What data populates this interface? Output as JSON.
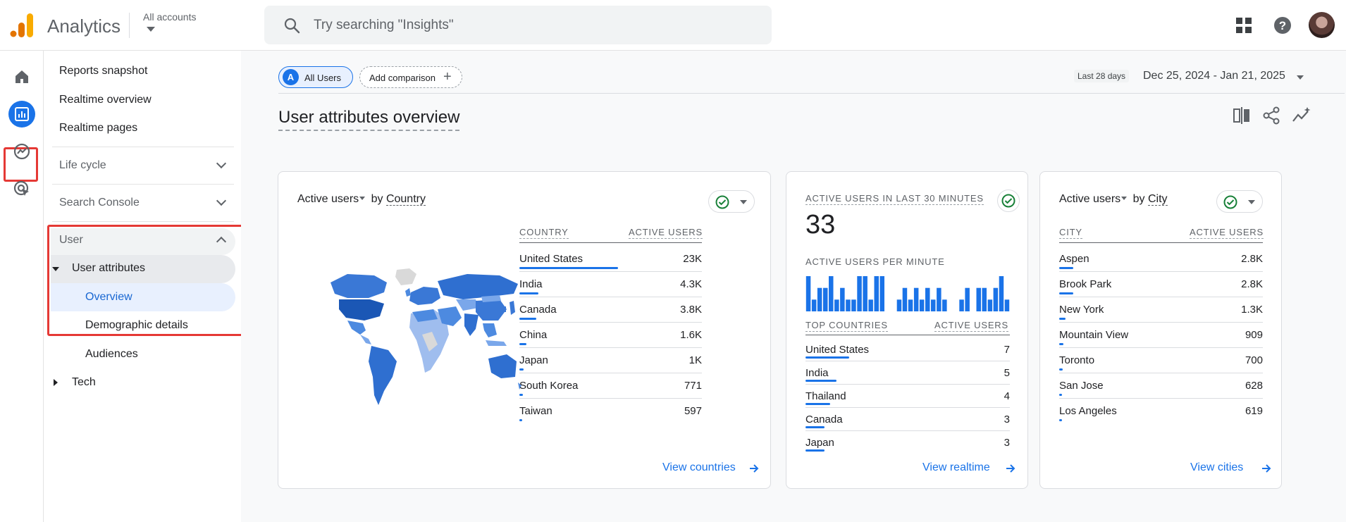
{
  "app": {
    "title": "Analytics",
    "account_label": "All accounts"
  },
  "search": {
    "placeholder": "Try searching \"Insights\""
  },
  "icons": {
    "logo": "analytics-logo-icon",
    "search": "search-icon",
    "apps": "apps-grid-icon",
    "help": "help-icon",
    "rail": [
      "home-icon",
      "reports-icon",
      "explore-icon",
      "advertising-icon"
    ],
    "toolbar": [
      "compare-icon",
      "share-icon",
      "insights-icon"
    ]
  },
  "colors": {
    "accent": "#1a73e8",
    "highlight": "#e53935",
    "success": "#188038"
  },
  "nav": {
    "top_items": [
      "Reports snapshot",
      "Realtime overview",
      "Realtime pages"
    ],
    "sections": {
      "life_cycle": "Life cycle",
      "search_console": "Search Console",
      "user": "User"
    },
    "user_attributes": "User attributes",
    "user_sub": [
      "Overview",
      "Demographic details"
    ],
    "audiences": "Audiences",
    "tech": "Tech"
  },
  "header": {
    "all_users": "All Users",
    "all_users_badge": "A",
    "add_comparison": "Add comparison",
    "last_days": "Last 28 days",
    "date_range": "Dec 25, 2024 - Jan 21, 2025",
    "page_title": "User attributes overview"
  },
  "country_card": {
    "metric": "Active users",
    "by": "by",
    "dimension": "Country",
    "col_country": "COUNTRY",
    "col_users": "ACTIVE USERS",
    "rows": [
      {
        "name": "United States",
        "value": "23K",
        "share": 1.0
      },
      {
        "name": "India",
        "value": "4.3K",
        "share": 0.19
      },
      {
        "name": "Canada",
        "value": "3.8K",
        "share": 0.17
      },
      {
        "name": "China",
        "value": "1.6K",
        "share": 0.07
      },
      {
        "name": "Japan",
        "value": "1K",
        "share": 0.045
      },
      {
        "name": "South Korea",
        "value": "771",
        "share": 0.034
      },
      {
        "name": "Taiwan",
        "value": "597",
        "share": 0.026
      }
    ],
    "link": "View countries"
  },
  "realtime_card": {
    "title": "ACTIVE USERS IN LAST 30 MINUTES",
    "count": "33",
    "per_minute_label": "ACTIVE USERS PER MINUTE",
    "per_minute": [
      3,
      1,
      2,
      2,
      3,
      1,
      2,
      1,
      1,
      3,
      3,
      1,
      3,
      3,
      0,
      0,
      1,
      2,
      1,
      2,
      1,
      2,
      1,
      2,
      1,
      0,
      0,
      1,
      2,
      0,
      2,
      2,
      1,
      2,
      3,
      1
    ],
    "col_countries": "TOP COUNTRIES",
    "col_users": "ACTIVE USERS",
    "rows": [
      {
        "name": "United States",
        "value": "7",
        "share": 1.0
      },
      {
        "name": "India",
        "value": "5",
        "share": 0.71
      },
      {
        "name": "Thailand",
        "value": "4",
        "share": 0.57
      },
      {
        "name": "Canada",
        "value": "3",
        "share": 0.43
      },
      {
        "name": "Japan",
        "value": "3",
        "share": 0.43
      }
    ],
    "link": "View realtime"
  },
  "city_card": {
    "metric": "Active users",
    "by": "by",
    "dimension": "City",
    "col_city": "CITY",
    "col_users": "ACTIVE USERS",
    "rows": [
      {
        "name": "Aspen",
        "value": "2.8K",
        "share": 1.0
      },
      {
        "name": "Brook Park",
        "value": "2.8K",
        "share": 1.0
      },
      {
        "name": "New York",
        "value": "1.3K",
        "share": 0.46
      },
      {
        "name": "Mountain View",
        "value": "909",
        "share": 0.32
      },
      {
        "name": "Toronto",
        "value": "700",
        "share": 0.25
      },
      {
        "name": "San Jose",
        "value": "628",
        "share": 0.22
      },
      {
        "name": "Los Angeles",
        "value": "619",
        "share": 0.22
      }
    ],
    "link": "View cities"
  }
}
